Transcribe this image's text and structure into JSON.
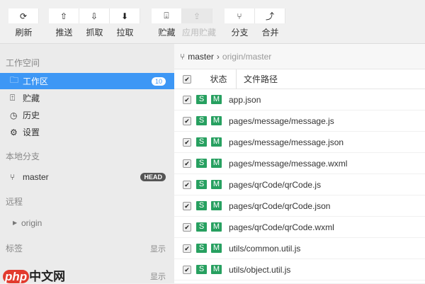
{
  "toolbar": {
    "buttons": [
      {
        "label": "刷新",
        "icon": "refresh-icon",
        "glyph": "⟳",
        "disabled": false
      },
      {
        "label": "推送",
        "icon": "push-icon",
        "glyph": "⇧",
        "disabled": false
      },
      {
        "label": "抓取",
        "icon": "fetch-icon",
        "glyph": "⇩",
        "disabled": false
      },
      {
        "label": "拉取",
        "icon": "pull-icon",
        "glyph": "⬇",
        "disabled": false
      },
      {
        "label": "贮藏",
        "icon": "stash-icon",
        "glyph": "⍗",
        "disabled": false
      },
      {
        "label": "应用贮藏",
        "icon": "apply-stash-icon",
        "glyph": "⇪",
        "disabled": true
      },
      {
        "label": "分支",
        "icon": "branch-icon",
        "glyph": "⑂",
        "disabled": false
      },
      {
        "label": "合并",
        "icon": "merge-icon",
        "glyph": "⤴",
        "disabled": false
      }
    ]
  },
  "sidebar": {
    "workspace_title": "工作空间",
    "items": [
      {
        "label": "工作区",
        "icon": "folder-icon",
        "glyph": "🗀",
        "count": "10"
      },
      {
        "label": "贮藏",
        "icon": "stash-icon",
        "glyph": "⍐"
      },
      {
        "label": "历史",
        "icon": "history-icon",
        "glyph": "◷"
      },
      {
        "label": "设置",
        "icon": "gear-icon",
        "glyph": "⚙"
      }
    ],
    "local_title": "本地分支",
    "branch": "master",
    "head": "HEAD",
    "remote_title": "远程",
    "remote": "origin",
    "tags_title": "标签",
    "show": "显示",
    "show2": "显示"
  },
  "main": {
    "branch": "master",
    "upstream": "origin/master",
    "col_status": "状态",
    "col_path": "文件路径",
    "status_s": "S",
    "status_m": "M",
    "files": [
      "app.json",
      "pages/message/message.js",
      "pages/message/message.json",
      "pages/message/message.wxml",
      "pages/qrCode/qrCode.js",
      "pages/qrCode/qrCode.json",
      "pages/qrCode/qrCode.wxml",
      "utils/common.util.js",
      "utils/object.util.js"
    ]
  },
  "watermark": {
    "php": "php",
    "text": "中文网"
  }
}
